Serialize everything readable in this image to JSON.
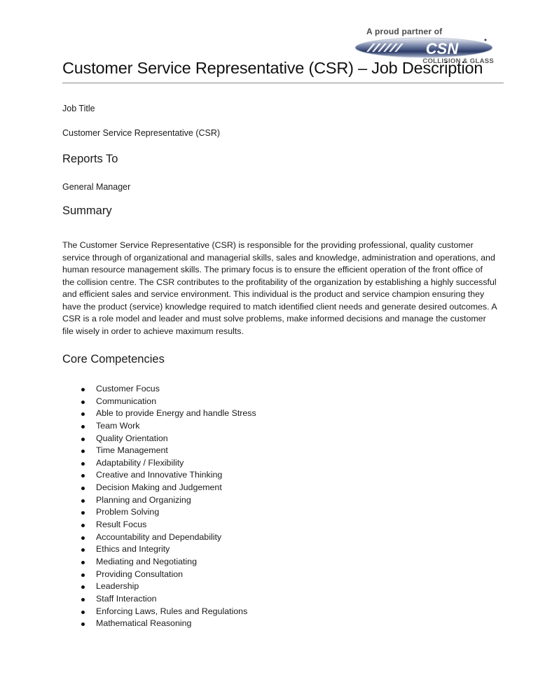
{
  "logo": {
    "tagline": "A proud partner of",
    "brand": "CSN",
    "subtitle": "COLLISION & GLASS",
    "colors": {
      "badge_dark": "#2a3a66",
      "badge_light": "#dfe4ee",
      "text": "#4a4a4a"
    }
  },
  "document": {
    "title": "Customer Service Representative (CSR) – Job Description",
    "job_title_label": "Job Title",
    "job_title_value": "Customer Service Representative (CSR)",
    "reports_to_heading": "Reports To",
    "reports_to_value": "General Manager",
    "summary_heading": "Summary",
    "summary_text": "The Customer Service Representative (CSR) is responsible for the providing professional, quality customer service through of organizational and managerial skills, sales and knowledge, administration and operations, and human resource management skills. The primary focus is to ensure the efficient operation of the front office of the collision centre. The CSR contributes to the profitability of the organization by establishing a highly successful and efficient sales and service environment. This individual is the product and service champion ensuring they have the product (service) knowledge required to match identified client needs and generate desired outcomes.  A CSR is a role model and leader and must solve problems, make informed decisions and manage the customer file wisely in order to achieve maximum results.",
    "competencies_heading": "Core Competencies",
    "competencies": [
      "Customer Focus",
      "Communication",
      "Able to provide Energy and  handle Stress",
      "Team Work",
      "Quality Orientation",
      "Time Management",
      "Adaptability / Flexibility",
      "Creative and Innovative Thinking",
      "Decision Making and Judgement",
      "Planning and Organizing",
      "Problem Solving",
      "Result Focus",
      "Accountability and Dependability",
      "Ethics and Integrity",
      "Mediating and Negotiating",
      "Providing Consultation",
      "Leadership",
      "Staff Interaction",
      "Enforcing Laws, Rules and Regulations",
      "Mathematical Reasoning"
    ]
  }
}
